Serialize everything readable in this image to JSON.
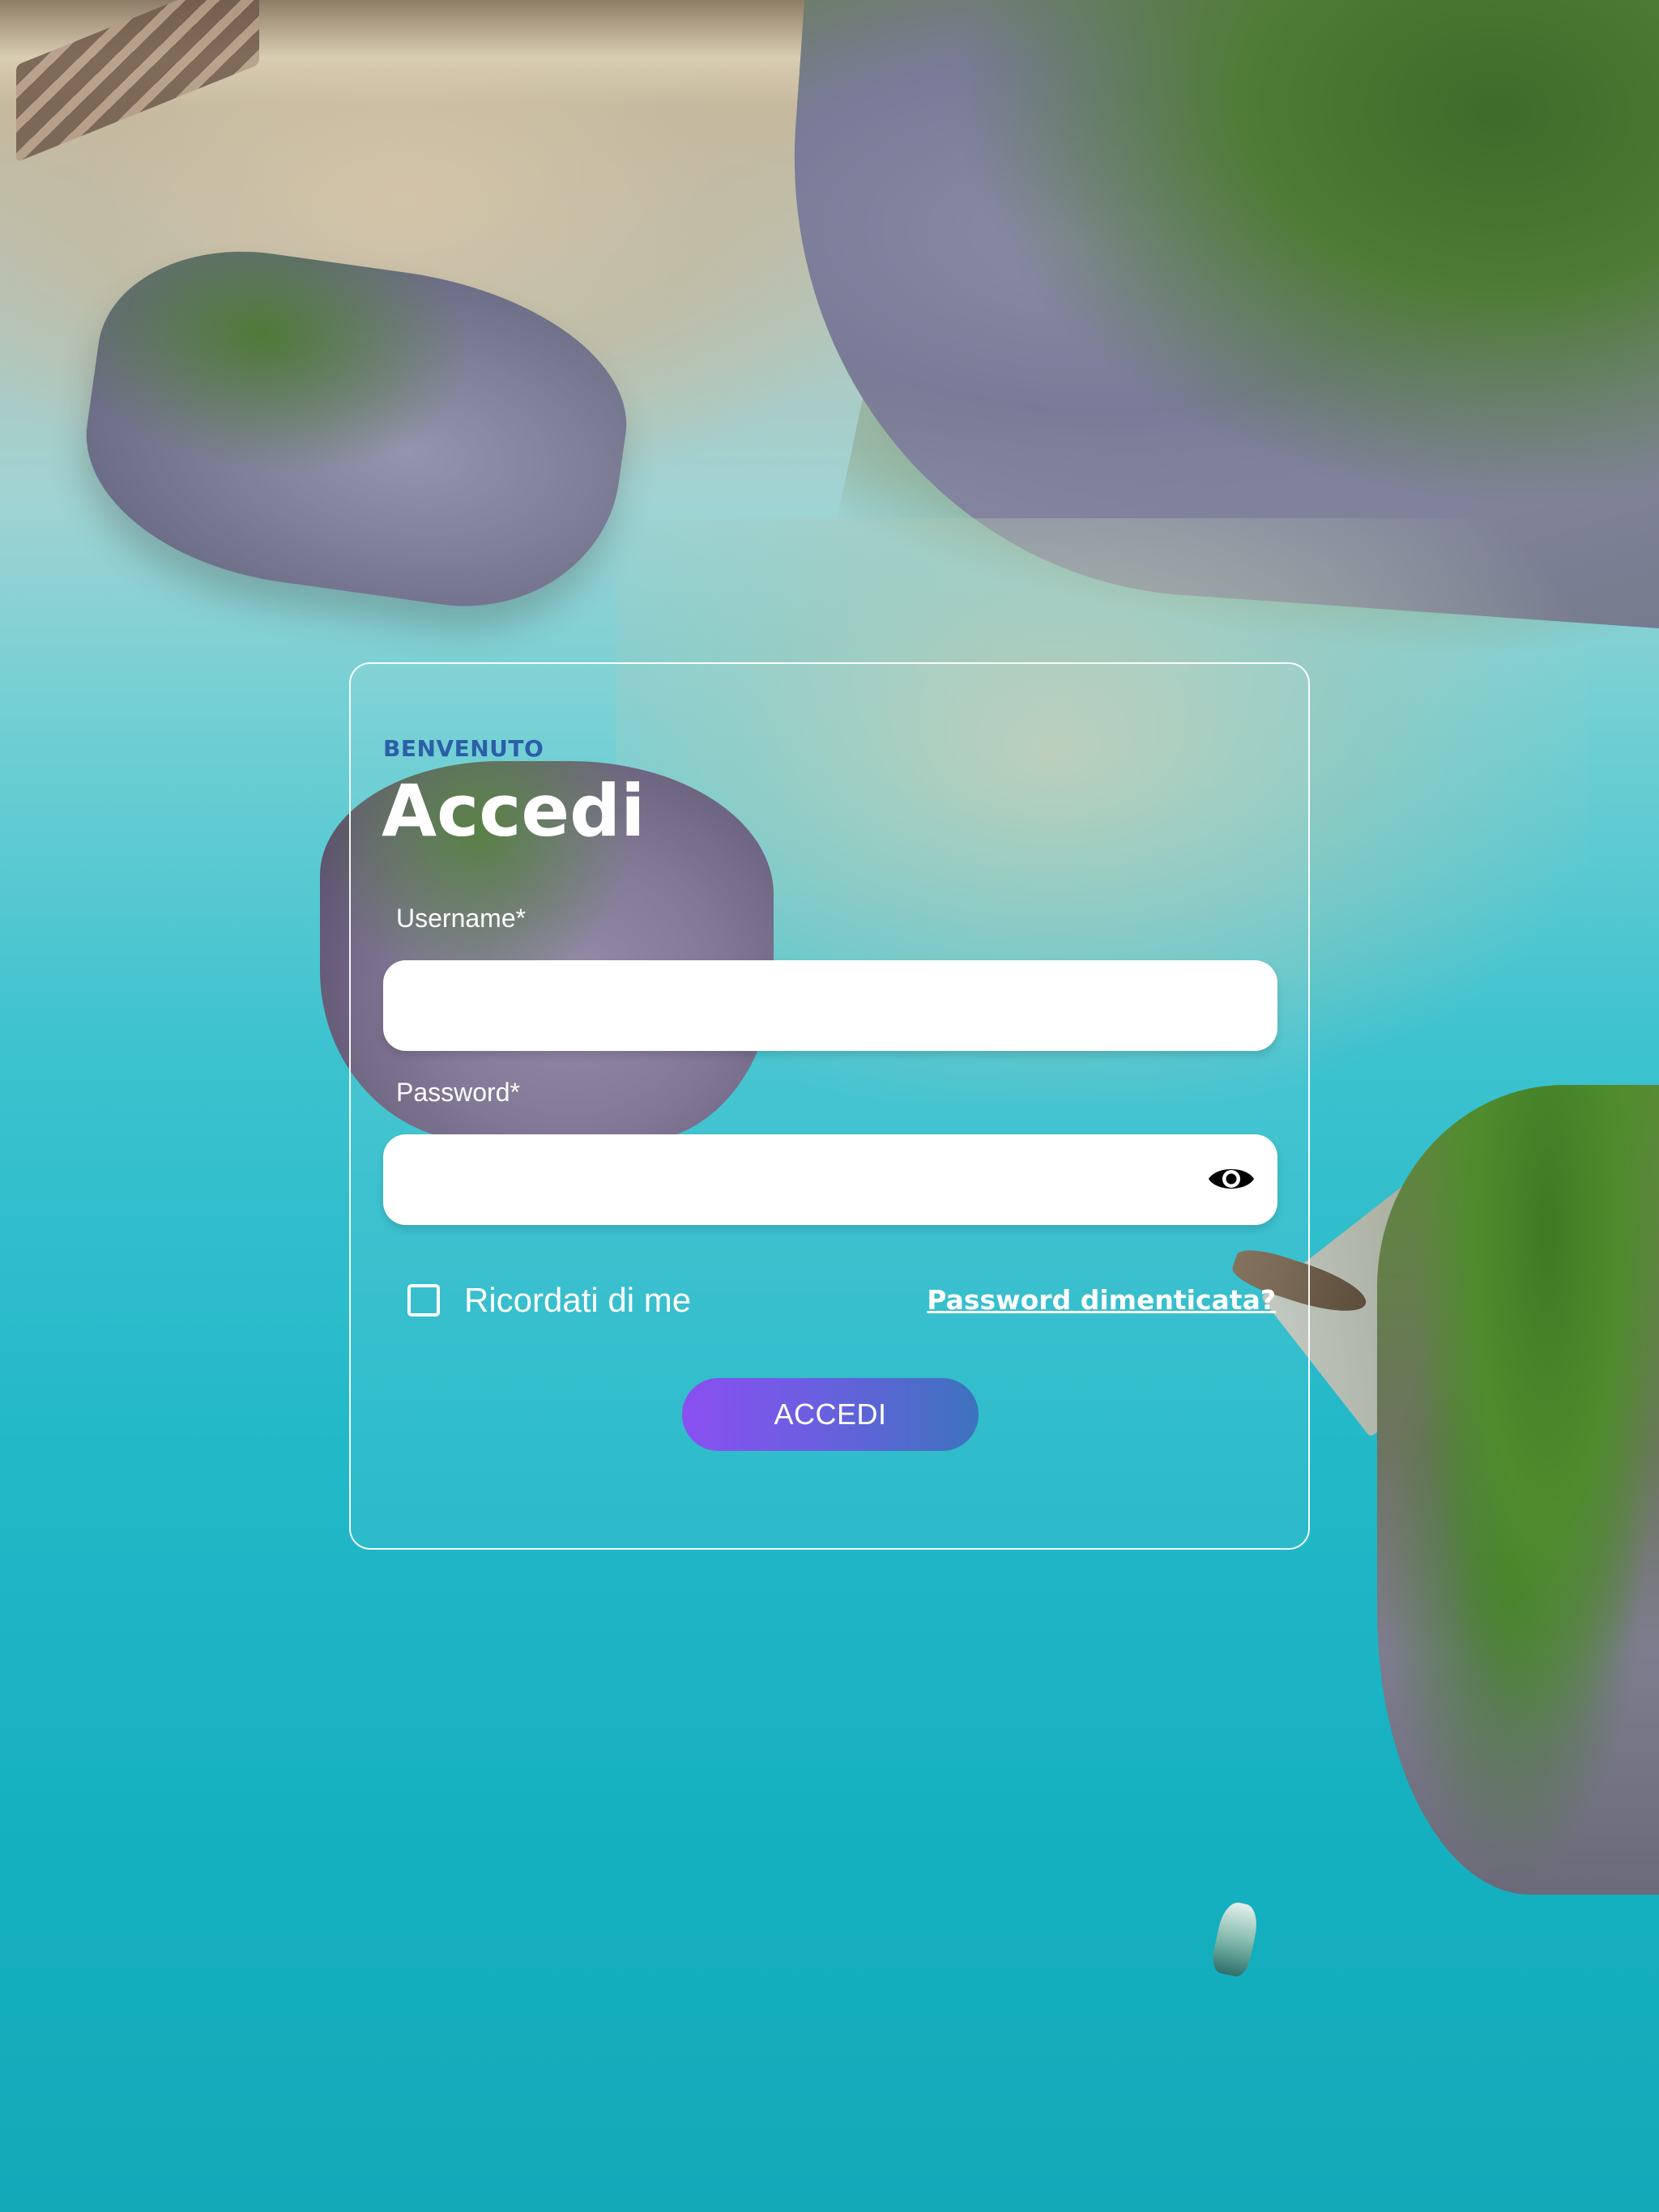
{
  "login": {
    "eyebrow": "BENVENUTO",
    "title": "Accedi",
    "username": {
      "label": "Username*",
      "value": "",
      "placeholder": ""
    },
    "password": {
      "label": "Password*",
      "value": "",
      "placeholder": "",
      "toggle_icon": "eye-icon"
    },
    "remember_me": {
      "label": "Ricordati di me",
      "checked": false
    },
    "forgot_password_link": "Password dimenticata?",
    "submit_label": "ACCEDI"
  },
  "colors": {
    "eyebrow": "#2c5fa8",
    "submit_gradient_start": "#8b4ff2",
    "submit_gradient_end": "#3d73bd",
    "card_border": "#ffffff"
  }
}
